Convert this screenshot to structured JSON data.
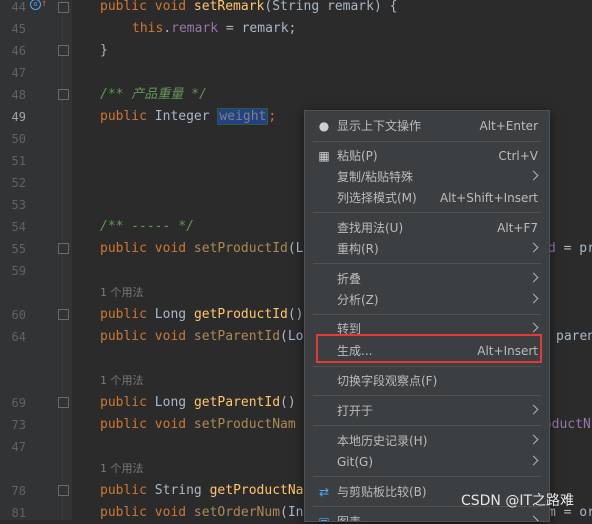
{
  "editor": {
    "line_numbers": [
      "44",
      "45",
      "46",
      "47",
      "48",
      "49",
      "50",
      "51",
      "52",
      "53",
      "54",
      "55",
      "59",
      "",
      "60",
      "64",
      "",
      "69",
      "73",
      "",
      "78",
      "81"
    ],
    "usage_hint": "1 个用法",
    "code": {
      "l44_kw": "public void ",
      "l44_fn": "setRemark",
      "l44_rest": "(String remark) {",
      "l45_kw": "this",
      "l45_dot": ".",
      "l45_fld": "remark",
      "l45_rest": " = remark;",
      "l46": "}",
      "l48_comment": "/** 产品重量 */",
      "l49_kw": "public ",
      "l49_type": "Integer ",
      "l49_sel": "weight",
      "l49_end": ";",
      "l54_comment": "/** ----- */",
      "l55_kw": "public void ",
      "l55_fn": "setProductId",
      "l55_rest": "(L",
      "l55_tail": "d = pr",
      "l60_kw": "public ",
      "l60_type": "Long ",
      "l60_fn": "getProductId",
      "l60_rest": "()",
      "l64_kw": "public void ",
      "l64_fn": "setParentId",
      "l64_rest": "(Lo",
      "l64_tail": "parent",
      "l69_kw": "public ",
      "l69_type": "Long ",
      "l69_fn": "getParentId",
      "l69_rest": "()",
      "l73_kw": "public void ",
      "l73_fn": "setProductNam",
      "l73_tail": "roductN",
      "l78_kw": "public ",
      "l78_type": "String ",
      "l78_fn": "getProductNa",
      "l81_kw": "public void ",
      "l81_fn": "setOrderNum",
      "l81_rest": "(In",
      "l81_tail": "m = or"
    }
  },
  "menu": {
    "items": [
      {
        "label": "显示上下文操作",
        "shortcut": "Alt+Enter",
        "icon": "bulb-icon"
      },
      {
        "label": "粘贴(P)",
        "shortcut": "Ctrl+V",
        "icon": "clipboard-icon"
      },
      {
        "label": "复制/粘贴特殊",
        "shortcut": ""
      },
      {
        "label": "列选择模式(M)",
        "shortcut": "Alt+Shift+Insert"
      },
      {
        "label": "查找用法(U)",
        "shortcut": "Alt+F7"
      },
      {
        "label": "重构(R)",
        "shortcut": ""
      },
      {
        "label": "折叠",
        "shortcut": ""
      },
      {
        "label": "分析(Z)",
        "shortcut": ""
      },
      {
        "label": "转到",
        "shortcut": ""
      },
      {
        "label": "生成...",
        "shortcut": "Alt+Insert"
      },
      {
        "label": "切换字段观察点(F)",
        "shortcut": ""
      },
      {
        "label": "打开于",
        "shortcut": ""
      },
      {
        "label": "本地历史记录(H)",
        "shortcut": ""
      },
      {
        "label": "Git(G)",
        "shortcut": ""
      },
      {
        "label": "与剪贴板比较(B)",
        "shortcut": "",
        "icon": "compare-icon"
      },
      {
        "label": "图表",
        "shortcut": ""
      }
    ]
  },
  "watermark": "CSDN @IT之路难",
  "colors": {
    "highlight_border": "#e53935",
    "menu_bg": "#3c3f41",
    "editor_bg": "#2b2b2b"
  }
}
